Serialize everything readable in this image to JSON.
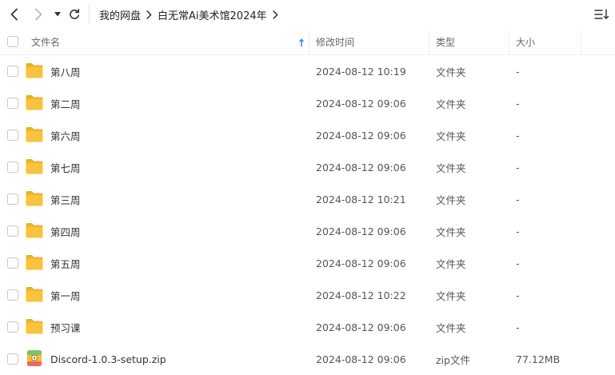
{
  "toolbar": {
    "back_icon": "chevron-left-icon",
    "forward_icon": "chevron-right-icon",
    "history_icon": "caret-down-icon",
    "refresh_icon": "refresh-icon",
    "view_icon": "list-view-icon"
  },
  "breadcrumb": [
    "我的网盘",
    "白无常Ai美术馆2024年"
  ],
  "header": {
    "name": "文件名",
    "modified": "修改时间",
    "type": "类型",
    "size": "大小",
    "sort_icon": "arrow-up-icon"
  },
  "files": [
    {
      "name": "第八周",
      "modified": "2024-08-12 10:19",
      "type": "文件夹",
      "size": "-",
      "icon": "folder-icon"
    },
    {
      "name": "第二周",
      "modified": "2024-08-12 09:06",
      "type": "文件夹",
      "size": "-",
      "icon": "folder-icon"
    },
    {
      "name": "第六周",
      "modified": "2024-08-12 09:06",
      "type": "文件夹",
      "size": "-",
      "icon": "folder-icon"
    },
    {
      "name": "第七周",
      "modified": "2024-08-12 09:06",
      "type": "文件夹",
      "size": "-",
      "icon": "folder-icon"
    },
    {
      "name": "第三周",
      "modified": "2024-08-12 10:21",
      "type": "文件夹",
      "size": "-",
      "icon": "folder-icon"
    },
    {
      "name": "第四周",
      "modified": "2024-08-12 09:06",
      "type": "文件夹",
      "size": "-",
      "icon": "folder-icon"
    },
    {
      "name": "第五周",
      "modified": "2024-08-12 09:06",
      "type": "文件夹",
      "size": "-",
      "icon": "folder-icon"
    },
    {
      "name": "第一周",
      "modified": "2024-08-12 10:22",
      "type": "文件夹",
      "size": "-",
      "icon": "folder-icon"
    },
    {
      "name": "预习课",
      "modified": "2024-08-12 09:06",
      "type": "文件夹",
      "size": "-",
      "icon": "folder-icon"
    },
    {
      "name": "Discord-1.0.3-setup.zip",
      "modified": "2024-08-12 09:06",
      "type": "zip文件",
      "size": "77.12MB",
      "icon": "zip-archive-icon"
    }
  ],
  "colors": {
    "folder": "#F9C33C",
    "folder_tab": "#F2AE24",
    "accent": "#4A90E2"
  }
}
